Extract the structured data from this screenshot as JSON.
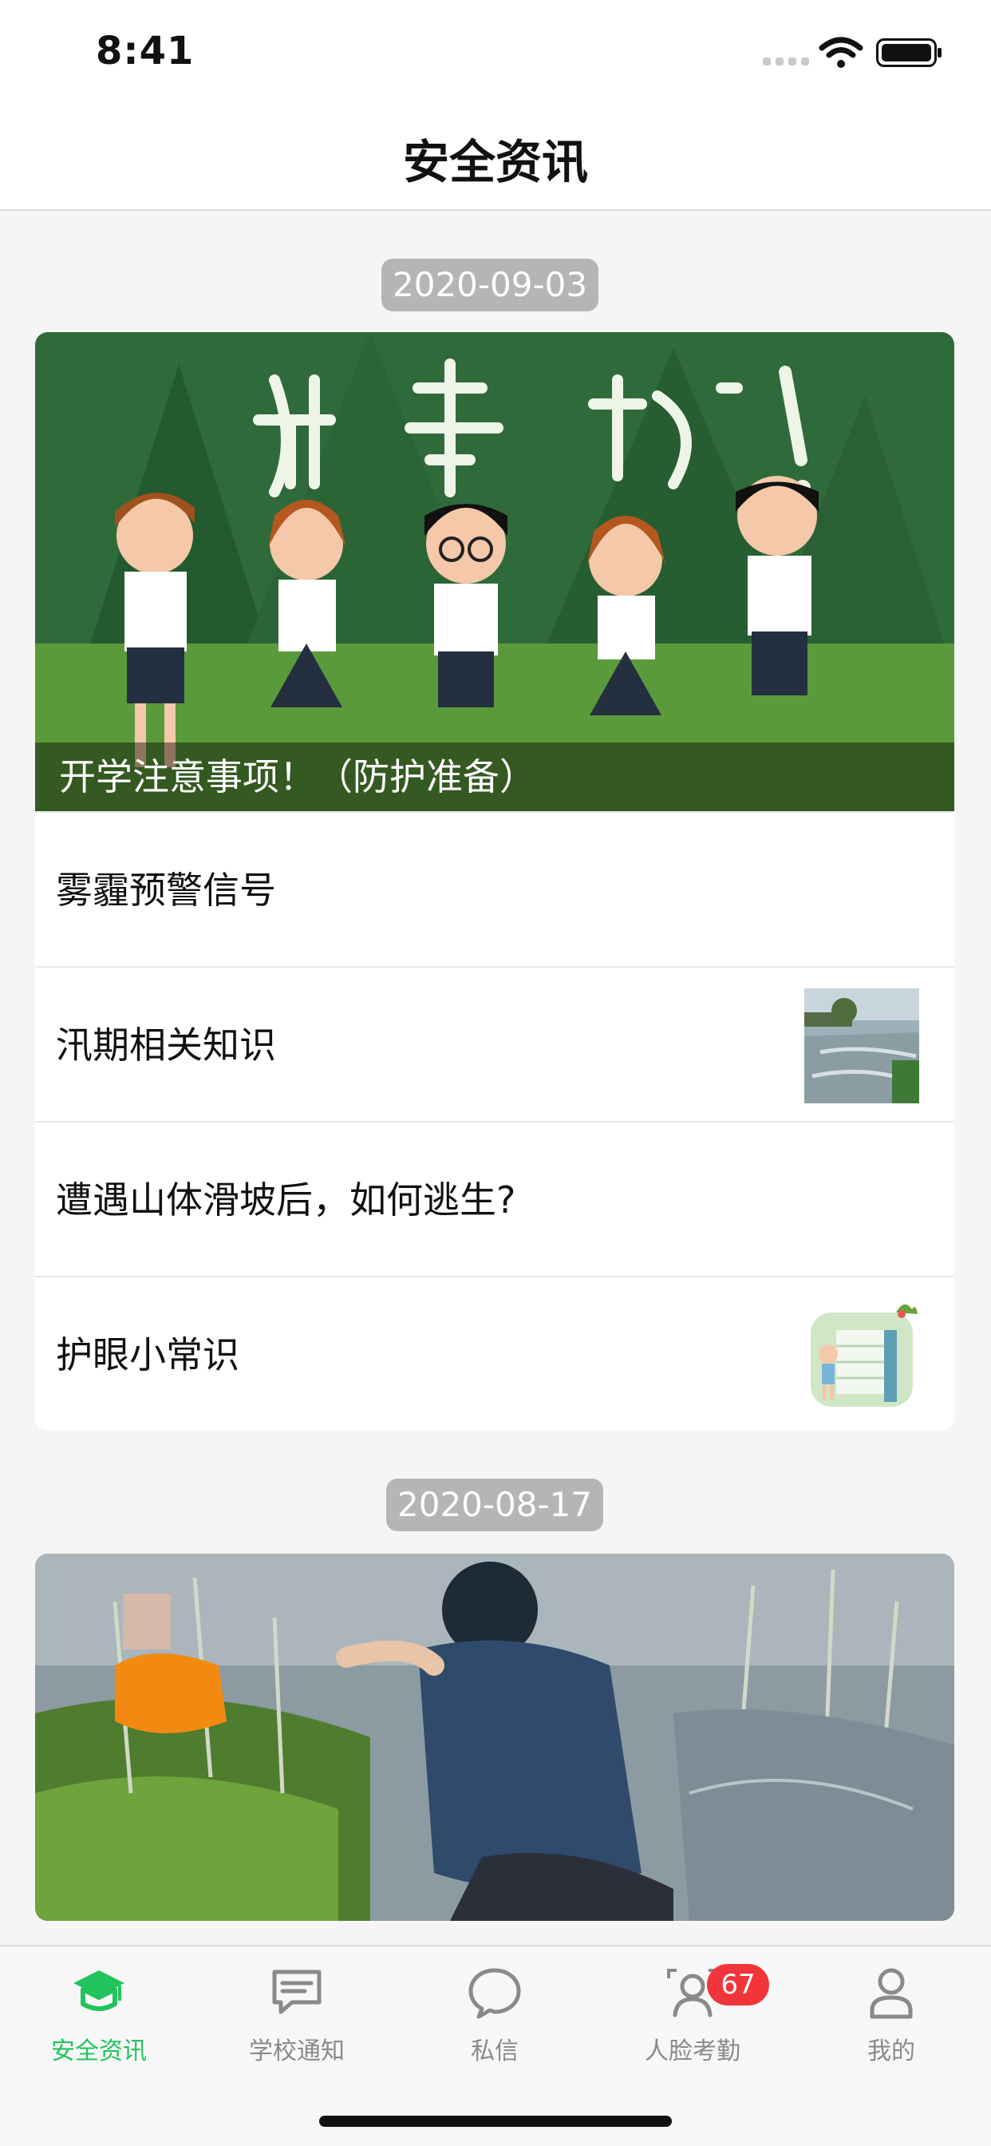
{
  "status_bar": {
    "time": "8:41"
  },
  "nav": {
    "title": "安全资讯"
  },
  "sections": [
    {
      "date": "2020-09-03",
      "featured": {
        "caption": "开学注意事项！（防护准备）",
        "image_icon": "back-to-school-illustration"
      },
      "items": [
        {
          "label": "雾霾预警信号",
          "thumb": ""
        },
        {
          "label": "汛期相关知识",
          "thumb": "flood-road-thumbnail"
        },
        {
          "label": "遭遇山体滑坡后，如何逃生?",
          "thumb": ""
        },
        {
          "label": "护眼小常识",
          "thumb": "eye-care-thumbnail"
        }
      ]
    },
    {
      "date": "2020-08-17",
      "featured": {
        "caption": "",
        "image_icon": "river-rescue-photo"
      }
    }
  ],
  "tabbar": {
    "tabs": [
      {
        "label": "安全资讯",
        "icon": "graduation-cap-icon",
        "active": true
      },
      {
        "label": "学校通知",
        "icon": "message-square-icon"
      },
      {
        "label": "私信",
        "icon": "chat-bubble-icon"
      },
      {
        "label": "人脸考勤",
        "icon": "face-scan-icon",
        "badge": "67"
      },
      {
        "label": "我的",
        "icon": "user-icon"
      }
    ]
  },
  "colors": {
    "accent": "#21c45c",
    "badge": "#f2353a",
    "inactive": "#8a8a8a"
  }
}
